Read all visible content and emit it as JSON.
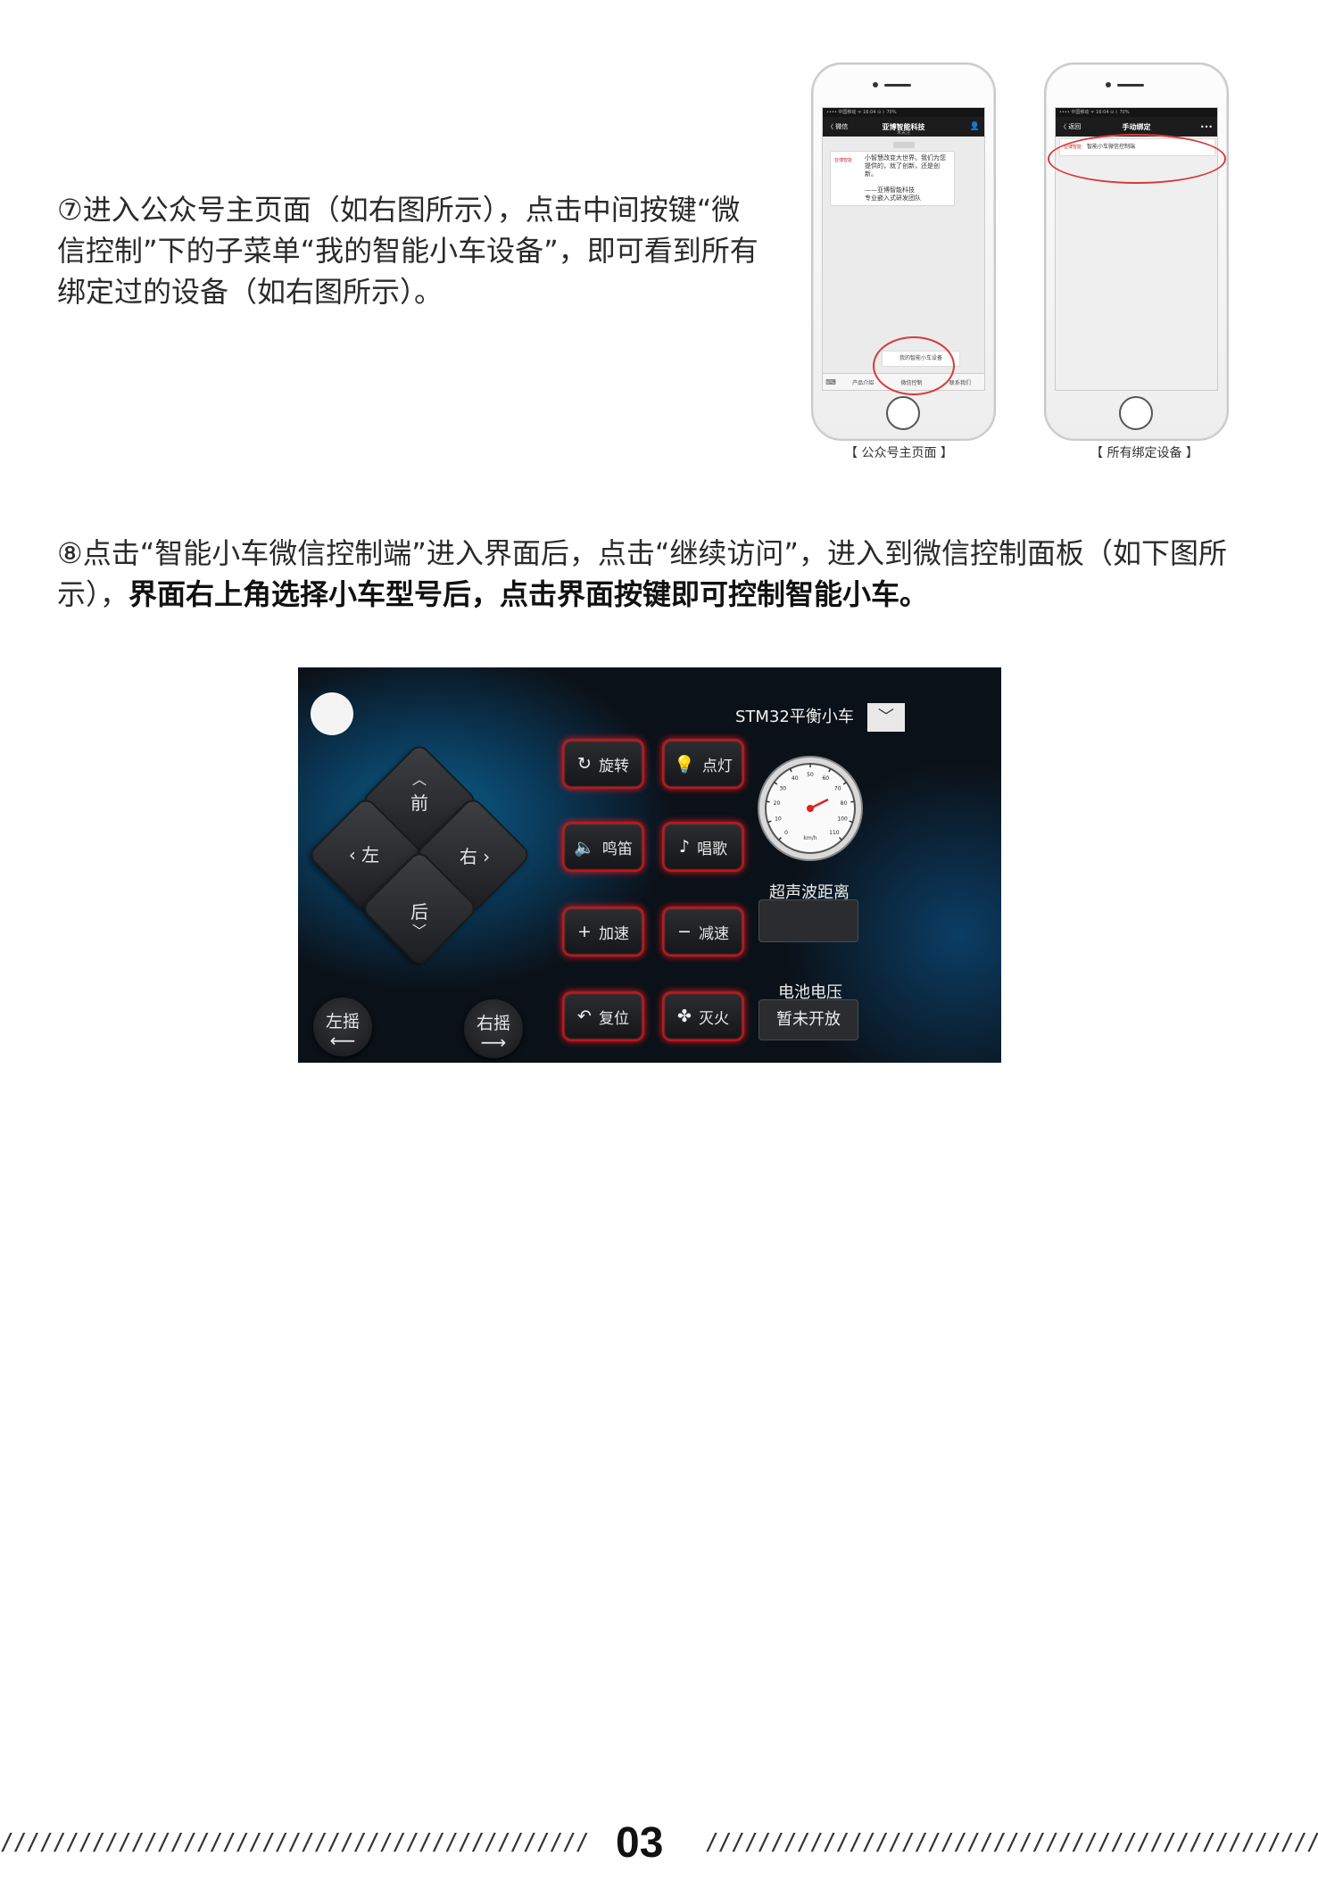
{
  "step7": {
    "text": "⑦进入公众号主页面（如右图所示），点击中间按键“微信控制”下的子菜单“我的智能小车设备”，即可看到所有绑定过的设备（如右图所示）。"
  },
  "phone1": {
    "status": "•••• 中国移动 ᯤ   16:04   ⊙ ᛒ 70%",
    "back": "〈 微信",
    "title": "亚博智能科技",
    "subtitle": "未关注",
    "profile_icon": "person-icon",
    "logo_text": "亚博智能",
    "message": "小智慧改变大世界。我们为您提供的，就了创新，还是创新。\n\n——亚博智能科技\n专业嵌入式研发团队",
    "popup": "我的智能小车设备",
    "menu": [
      "产品介绍",
      "微信控制",
      "联系我们"
    ],
    "caption": "【 公众号主页面 】"
  },
  "phone2": {
    "status": "•••• 中国移动 ᯤ   16:04   ⊙ ᛒ 70%",
    "back": "〈 返回",
    "title": "手动绑定",
    "more": "•••",
    "logo_text": "亚博智能",
    "device": "智能小车微信控制端",
    "caption": "【 所有绑定设备 】"
  },
  "step8": {
    "text_normal": "⑧点击“智能小车微信控制端”进入界面后，点击“继续访问”，进入到微信控制面板（如下图所示），",
    "text_bold": "界面右上角选择小车型号后，点击界面按键即可控制智能小车。"
  },
  "panel": {
    "model_select": "STM32平衡小车",
    "dpad": {
      "up": "前",
      "left": "左",
      "right": "右",
      "down": "后"
    },
    "rock_left": "左摇",
    "rock_right": "右摇",
    "buttons": [
      {
        "label": "旋转",
        "icon": "rotate-icon"
      },
      {
        "label": "点灯",
        "icon": "bulb-icon"
      },
      {
        "label": "鸣笛",
        "icon": "speaker-icon"
      },
      {
        "label": "唱歌",
        "icon": "music-icon"
      },
      {
        "label": "加速",
        "icon": "plus-icon"
      },
      {
        "label": "减速",
        "icon": "minus-icon"
      },
      {
        "label": "复位",
        "icon": "undo-icon"
      },
      {
        "label": "灭火",
        "icon": "fan-icon"
      }
    ],
    "ultrasonic_label": "超声波距离",
    "battery_label": "电池电压",
    "battery_value": "暂未开放",
    "gauge_ticks": [
      "0",
      "10",
      "20",
      "30",
      "40",
      "50",
      "60",
      "70",
      "80",
      "100",
      "110"
    ],
    "gauge_unit": "km/h"
  },
  "footer": {
    "page_number": "03"
  }
}
